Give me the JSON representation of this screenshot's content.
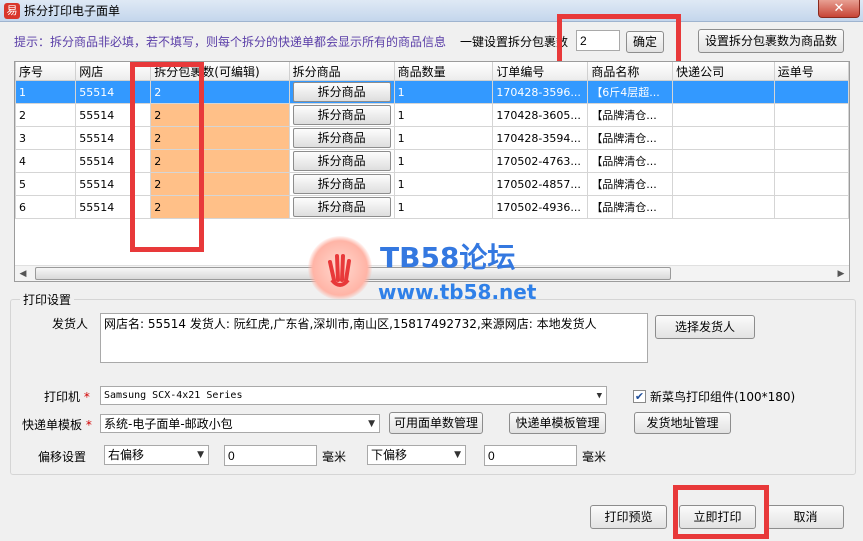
{
  "window": {
    "title": "拆分打印电子面单",
    "app_icon": "易",
    "close_symbol": "✕"
  },
  "hint": "提示：拆分商品非必填，若不填写，则每个拆分的快递单都会显示所有的商品信息",
  "bulk_set": {
    "label": "一键设置拆分包裹数",
    "value": "2",
    "confirm": "确定",
    "set_to_goods_count": "设置拆分包裹数为商品数"
  },
  "table": {
    "columns": [
      "序号",
      "网店",
      "拆分包裹数(可编辑)",
      "拆分商品",
      "商品数量",
      "订单编号",
      "商品名称",
      "快递公司",
      "运单号"
    ],
    "split_button": "拆分商品",
    "rows": [
      {
        "no": "1",
        "shop": "55514",
        "packages": "2",
        "qty": "1",
        "order": "170428-3596...",
        "goods": "【6斤4层超..."
      },
      {
        "no": "2",
        "shop": "55514",
        "packages": "2",
        "qty": "1",
        "order": "170428-3605...",
        "goods": "【品牌清仓..."
      },
      {
        "no": "3",
        "shop": "55514",
        "packages": "2",
        "qty": "1",
        "order": "170428-3594...",
        "goods": "【品牌清仓..."
      },
      {
        "no": "4",
        "shop": "55514",
        "packages": "2",
        "qty": "1",
        "order": "170502-4763...",
        "goods": "【品牌清仓..."
      },
      {
        "no": "5",
        "shop": "55514",
        "packages": "2",
        "qty": "1",
        "order": "170502-4857...",
        "goods": "【品牌清仓..."
      },
      {
        "no": "6",
        "shop": "55514",
        "packages": "2",
        "qty": "1",
        "order": "170502-4936...",
        "goods": "【品牌清仓..."
      }
    ]
  },
  "watermark": {
    "title": "TB58论坛",
    "url": "www.tb58.net"
  },
  "print_settings": {
    "group_label": "打印设置",
    "sender_label": "发货人",
    "sender_value": "网店名: 55514 发货人: 阮红虎,广东省,深圳市,南山区,15817492732,来源网店: 本地发货人",
    "choose_sender": "选择发货人",
    "printer_label": "打印机",
    "printer_value": "Samsung SCX-4x21 Series",
    "cainiao_checkbox": "新菜鸟打印组件(100*180)",
    "cainiao_checked": true,
    "template_label": "快递单模板",
    "template_value": "系统-电子面单-邮政小包",
    "available_count": "可用面单数管理",
    "template_manage": "快递单模板管理",
    "address_manage": "发货地址管理",
    "offset_label": "偏移设置",
    "offset_h_dir": "右偏移",
    "offset_h_value": "0",
    "offset_v_dir": "下偏移",
    "offset_v_value": "0",
    "unit": "毫米"
  },
  "buttons": {
    "preview": "打印预览",
    "print_now": "立即打印",
    "cancel": "取消"
  },
  "colors": {
    "selected_row": "#3399ff",
    "editable_cell": "#ffc088",
    "highlight_box": "#e8393a",
    "hint_text": "#5b3fa8"
  }
}
